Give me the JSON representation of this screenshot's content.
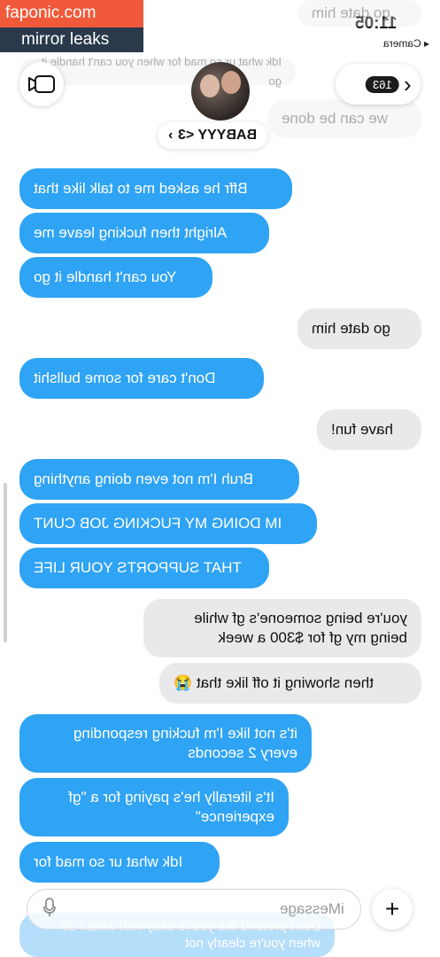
{
  "watermark": {
    "site": "faponic.com",
    "tag": "mirror leaks"
  },
  "status": {
    "time": "11:05",
    "back_app": "◂ Camera"
  },
  "header": {
    "unread_count": "163",
    "back_chevron": "‹",
    "contact_name": "BABYYY <3",
    "contact_chevron": "›"
  },
  "icons": {
    "video": "video-camera-icon",
    "mic": "microphone-icon",
    "plus": "plus-icon",
    "back": "chevron-left-icon"
  },
  "messages": [
    {
      "side": "gray",
      "text": "go date him",
      "faded": true
    },
    {
      "side": "gray",
      "text": "Idk what ur so mad for when you can't handle it go",
      "faded": true
    },
    {
      "side": "gray",
      "text": "we can be done",
      "faded": true
    },
    {
      "side": "blue",
      "text": "Bffr he asked me to talk like that"
    },
    {
      "side": "blue",
      "text": "Alright then fucking leave me"
    },
    {
      "side": "blue",
      "text": "You can't handle it go"
    },
    {
      "side": "gray",
      "text": "go date him"
    },
    {
      "side": "blue",
      "text": "Don't care for some bullshit"
    },
    {
      "side": "gray",
      "text": "have fun!"
    },
    {
      "side": "blue",
      "text": "Bruh I'm not even doing anything"
    },
    {
      "side": "blue",
      "text": "IM DOING MY FUCKING JOB CUNT"
    },
    {
      "side": "blue",
      "text": "THAT SUPPORTS YOUR LIFE"
    },
    {
      "side": "gray",
      "text": "you're being someone's gf while being my gf for $300 a week"
    },
    {
      "side": "gray",
      "text": "then showing it off like that 😭"
    },
    {
      "side": "blue",
      "text": "it's not like I'm fucking responding every 2 seconds"
    },
    {
      "side": "blue",
      "text": "It's literally he's paying for a \"gf experience\""
    },
    {
      "side": "blue",
      "text": "Idk what ur so mad for"
    },
    {
      "side": "blue",
      "text": "Don't pretend like you're okay with what I do when you're clearly not",
      "faded": true
    }
  ],
  "composer": {
    "placeholder": "iMessage"
  },
  "colors": {
    "imessage_blue": "#2fa3f4",
    "received_gray": "#e9e9eb"
  }
}
